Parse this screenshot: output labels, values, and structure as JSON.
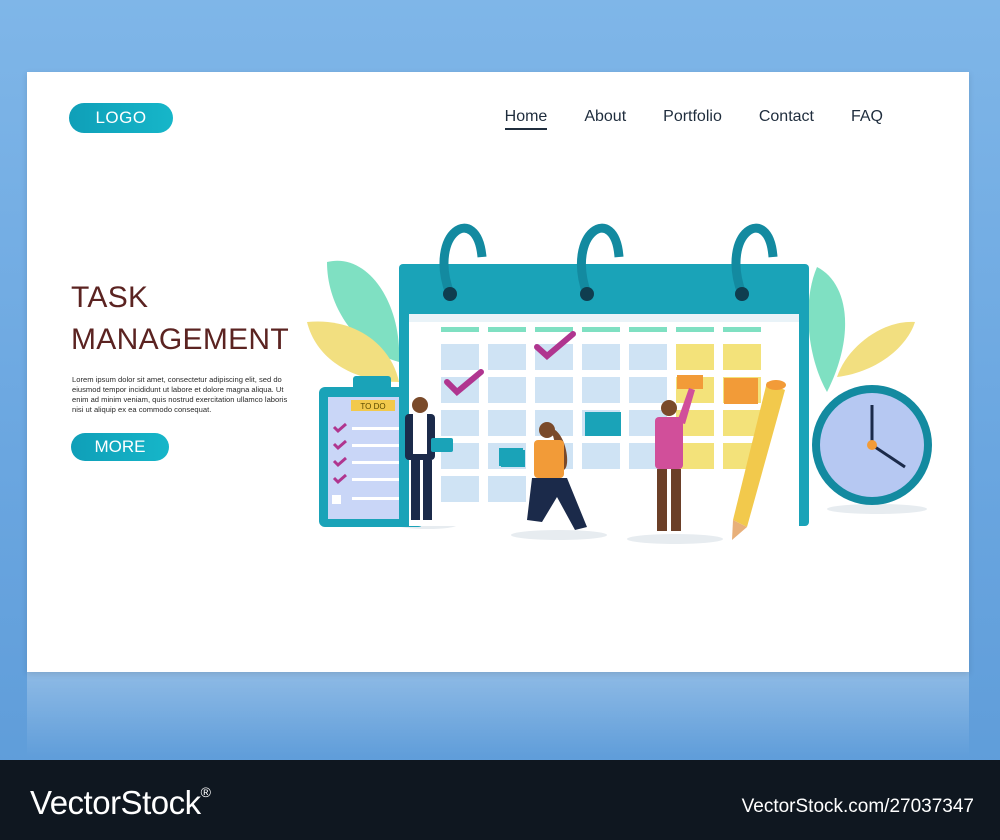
{
  "header": {
    "logo_label": "LOGO",
    "nav": [
      {
        "label": "Home",
        "active": true
      },
      {
        "label": "About",
        "active": false
      },
      {
        "label": "Portfolio",
        "active": false
      },
      {
        "label": "Contact",
        "active": false
      },
      {
        "label": "FAQ",
        "active": false
      }
    ]
  },
  "hero": {
    "title_line1": "TASK",
    "title_line2": "MANAGEMENT",
    "body": "Lorem ipsum dolor sit amet, consectetur adipiscing elit, sed do eiusmod tempor incididunt ut labore et dolore magna aliqua. Ut enim ad minim veniam, quis nostrud exercitation ullamco laboris nisi ut aliquip ex ea commodo consequat.",
    "more_label": "MORE"
  },
  "illustration": {
    "todo_label": "TO DO",
    "icons": [
      "calendar-icon",
      "clipboard-icon",
      "clock-icon",
      "pencil-icon"
    ]
  },
  "watermark": {
    "brand": "VectorStock",
    "reg_mark": "®",
    "site_id": "VectorStock.com/27037347"
  },
  "colors": {
    "accent": "#13a9c0",
    "title": "#5b2321",
    "calendar": "#1aa3b8",
    "check": "#b0358f",
    "sticky": "#f3e27a"
  }
}
